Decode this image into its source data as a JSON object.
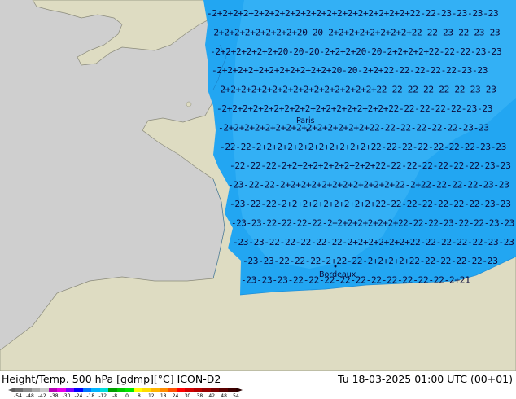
{
  "footer": {
    "title": "Height/Temp. 500 hPa [gdmp][°C] ICON-D2",
    "valid_time": "Tu 18-03-2025 01:00 UTC (00+01)"
  },
  "colorbar": {
    "colors": [
      "#6e6e6e",
      "#8c8c8c",
      "#aaaaaa",
      "#c8c8c8",
      "#b400b4",
      "#e600e6",
      "#7d00ff",
      "#0000ff",
      "#0078ff",
      "#00b4ff",
      "#00dcdc",
      "#00a000",
      "#00c800",
      "#00e600",
      "#ffff00",
      "#ffdc00",
      "#ffb400",
      "#ff8c00",
      "#ff5000",
      "#ff0000",
      "#d20000",
      "#b40000",
      "#960000",
      "#780000",
      "#5a0000",
      "#3c0000"
    ],
    "ticks": [
      "-54",
      "-48",
      "-42",
      "-38",
      "-30",
      "-24",
      "-18",
      "-12",
      "-8",
      "0",
      "8",
      "12",
      "18",
      "24",
      "30",
      "38",
      "42",
      "48",
      "54"
    ]
  },
  "map": {
    "colors": {
      "sea": "#cfcfcf",
      "land": "#dedcc2",
      "coast": "#8a8a7a",
      "temp_field": "#22a6f2",
      "temp_field_light": "#42b8f8",
      "label_ink": "#0a0a3a"
    },
    "cities": [
      "Paris",
      "Bordeaux"
    ],
    "contour_rows": [
      "-2+2+2+2+2+2+2+2+2+2+2+2+2+2+2+2+2+2+2+22-22-23-23-23-23",
      "-2+2+2+2+2+2+2+2+20-20-2+2+2+2+2+2+2+2+22-22-23-22-23-23",
      "-2+2+2+2+2+2+20-20-20-2+2+2+20-20-2+2+2+2+22-22-22-23-23",
      "-2+2+2+2+2+2+2+2+2+2+2+20-20-2+2+22-22-22-22-22-23-23",
      "-2+2+2+2+2+2+2+2+2+2+2+2+2+2+2+22-22-22-22-22-22-23-23",
      "-2+2+2+2+2+2+2+2+2+2+2+2+2+2+2+2+22-22-22-22-22-23-23",
      "-2+2+2+2+2+2+2+2+2+2+2+2+2+2+22-22-22-22-22-22-23-23",
      "-22-22-2+2+2+2+2+2+2+2+2+2+2+22-22-22-22-22-22-22-23-23",
      "-22-22-22-2+2+2+2+2+2+2+2+2+22-22-22-22-22-22-22-23-23",
      "-23-22-22-2+2+2+2+2+2+2+2+2+2+2+22-2+22-22-22-22-23-23",
      "-23-22-22-2+2+2+2+2+2+2+2+2+22-22-22-22-22-22-22-23-23",
      "-23-23-22-22-22-22-2+2+2+2+2+2+2+22-22-22-23-22-22-23-23",
      "-23-23-22-22-22-22-22-2+2+2+2+2+2+22-22-22-22-22-23-23",
      "-23-23-22-22-22-2+22-22-2+2+2+2+22-22-22-22-22-23",
      "-23-23-23-22-22-22-22-22-22-22-22-22-22-2+21"
    ]
  }
}
